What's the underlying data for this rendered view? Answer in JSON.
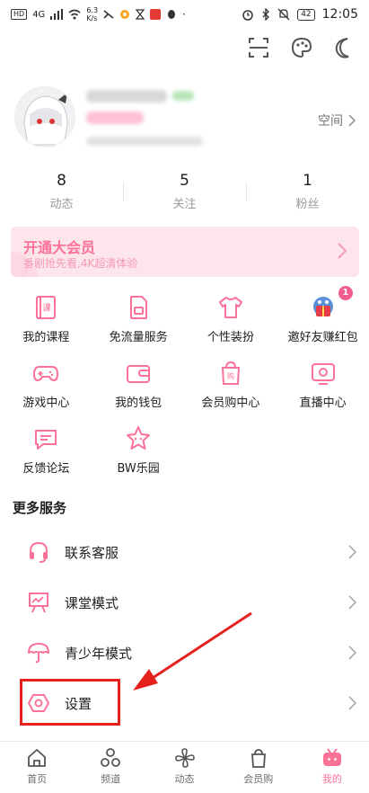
{
  "status_bar": {
    "left_chips": [
      "HD",
      "4G"
    ],
    "speed": "6.3",
    "speed_unit": "K/s",
    "battery": "42",
    "time": "12:05"
  },
  "top_icons": [
    "scan-icon",
    "palette-icon",
    "moon-icon"
  ],
  "profile": {
    "space_label": "空间"
  },
  "stats": [
    {
      "num": "8",
      "label": "动态"
    },
    {
      "num": "5",
      "label": "关注"
    },
    {
      "num": "1",
      "label": "粉丝"
    }
  ],
  "vip": {
    "title": "开通大会员",
    "subtitle": "番剧抢先看,4K超清体验"
  },
  "grid": [
    {
      "label": "我的课程",
      "icon": "course-icon"
    },
    {
      "label": "免流量服务",
      "icon": "sim-card-icon"
    },
    {
      "label": "个性装扮",
      "icon": "tshirt-icon"
    },
    {
      "label": "邀好友赚红包",
      "icon": "invite-gift-icon",
      "badge": "1"
    },
    {
      "label": "游戏中心",
      "icon": "gamepad-icon"
    },
    {
      "label": "我的钱包",
      "icon": "wallet-icon"
    },
    {
      "label": "会员购中心",
      "icon": "shopping-bag-icon"
    },
    {
      "label": "直播中心",
      "icon": "live-tv-icon"
    },
    {
      "label": "反馈论坛",
      "icon": "feedback-icon"
    },
    {
      "label": "BW乐园",
      "icon": "star-park-icon"
    }
  ],
  "more_services": {
    "title": "更多服务",
    "items": [
      {
        "label": "联系客服",
        "icon": "headset-icon"
      },
      {
        "label": "课堂模式",
        "icon": "classroom-icon"
      },
      {
        "label": "青少年模式",
        "icon": "umbrella-icon"
      },
      {
        "label": "设置",
        "icon": "settings-icon"
      }
    ]
  },
  "bottom_nav": [
    {
      "label": "首页",
      "icon": "home-icon"
    },
    {
      "label": "频道",
      "icon": "channel-icon"
    },
    {
      "label": "动态",
      "icon": "pinwheel-icon"
    },
    {
      "label": "会员购",
      "icon": "shop-icon"
    },
    {
      "label": "我的",
      "icon": "tv-mine-icon",
      "active": true
    }
  ],
  "colors": {
    "accent": "#fb7299",
    "annotation_red": "#e5211d"
  }
}
